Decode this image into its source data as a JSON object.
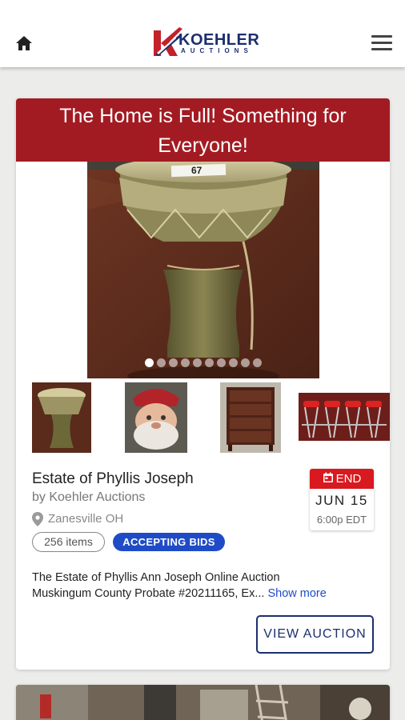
{
  "header": {
    "logo_name": "KOEHLER",
    "logo_sub": "AUCTIONS",
    "colors": {
      "brand_navy": "#1c2f6e",
      "brand_red": "#c4202a"
    }
  },
  "auction": {
    "banner_line1": "The Home is Full! Something for",
    "banner_line2": "Everyone!",
    "lot_tag": "67",
    "carousel": {
      "image_count": 10,
      "active_index": 0
    },
    "title": "Estate of Phyllis Joseph",
    "byline": "by Koehler Auctions",
    "location": "Zanesville OH",
    "end": {
      "label": "END",
      "date": "JUN 15",
      "time": "6:00p EDT"
    },
    "items_count": "256 items",
    "status": "ACCEPTING BIDS",
    "description_line1": "The Estate of Phyllis Ann Joseph Online Auction",
    "description_line2": "Muskingum County Probate #20211165, Ex...",
    "show_more": "Show more",
    "view_button": "VIEW AUCTION",
    "colors": {
      "banner": "#a31b22",
      "end_header": "#d8191f",
      "status_badge": "#1f4cc6"
    }
  }
}
